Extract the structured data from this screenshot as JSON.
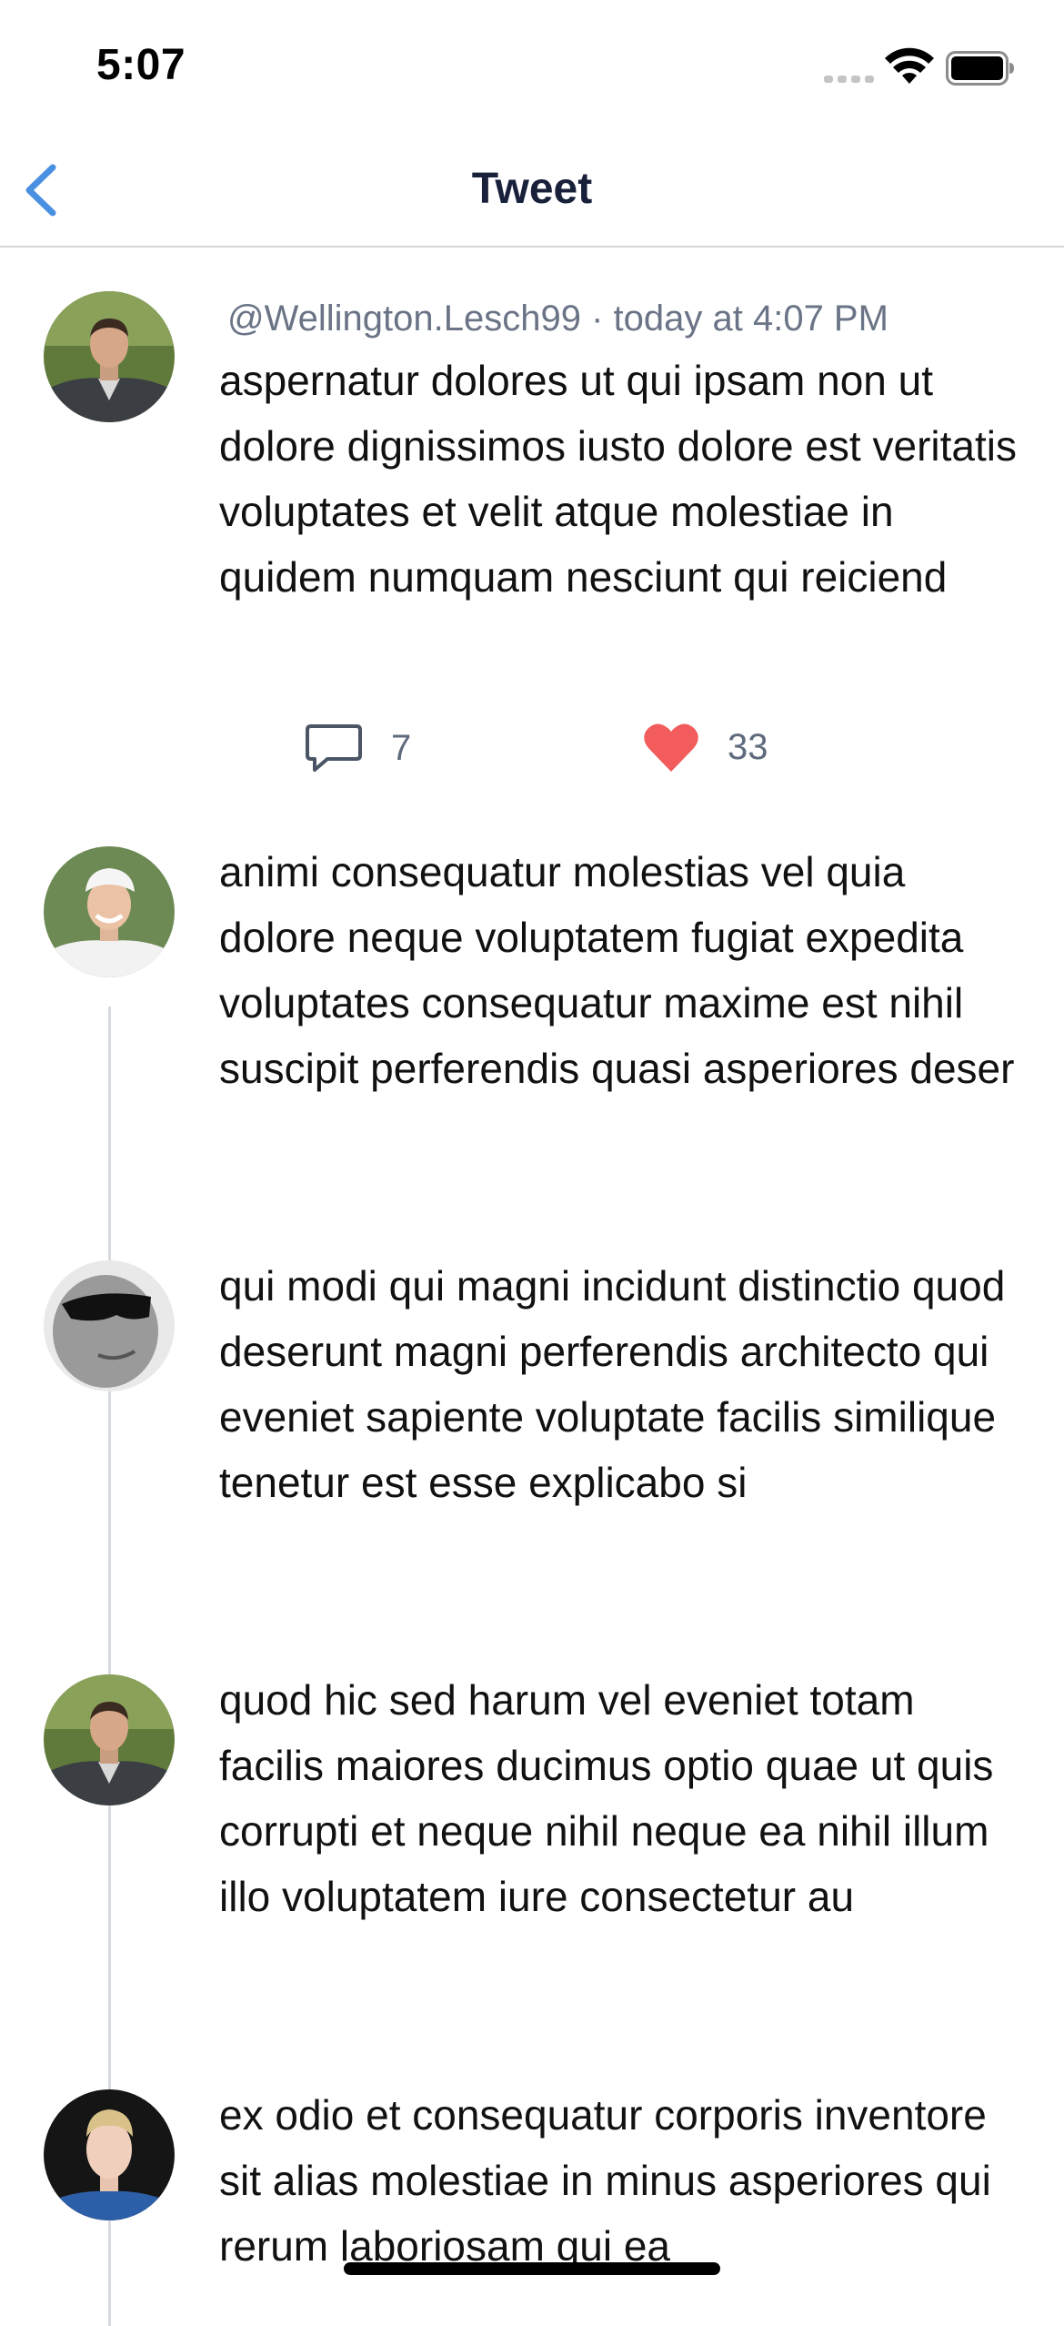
{
  "status_bar": {
    "time": "5:07"
  },
  "nav": {
    "title": "Tweet"
  },
  "main_tweet": {
    "handle": "@Wellington.Lesch99",
    "timestamp": "today at 4:07 PM",
    "meta_line": "@Wellington.Lesch99 · today at 4:07 PM",
    "text": "aspernatur dolores ut qui ipsam non ut dolore dignissimos iusto dolore est veritatis voluptates et velit atque molestiae in quidem numquam nesciunt qui reiciend",
    "reply_count": "7",
    "like_count": "33",
    "avatar": "avatar-man-jacket"
  },
  "replies": [
    {
      "text": "animi consequatur molestias vel quia dolore neque voluptatem fugiat expedita voluptates consequatur maxime est nihil suscipit perferendis quasi asperiores deser",
      "avatar": "avatar-man-cap"
    },
    {
      "text": "qui modi qui magni incidunt distinctio quod deserunt magni perferendis architecto qui eveniet sapiente voluptate facilis similique tenetur est esse explicabo si",
      "avatar": "avatar-man-sunglasses"
    },
    {
      "text": "quod hic sed harum vel eveniet totam facilis maiores ducimus optio quae ut quis corrupti et neque nihil neque ea nihil illum illo voluptatem iure consectetur au",
      "avatar": "avatar-man-jacket"
    },
    {
      "text": "ex odio et consequatur corporis inventore sit alias molestiae in minus asperiores qui rerum laboriosam qui ea",
      "avatar": "avatar-man-blond"
    }
  ],
  "colors": {
    "accent": "#4a90e2",
    "like": "#f25c5c",
    "meta": "#6a7486",
    "divider": "#d6d6da",
    "thread": "#d7dbe0"
  }
}
